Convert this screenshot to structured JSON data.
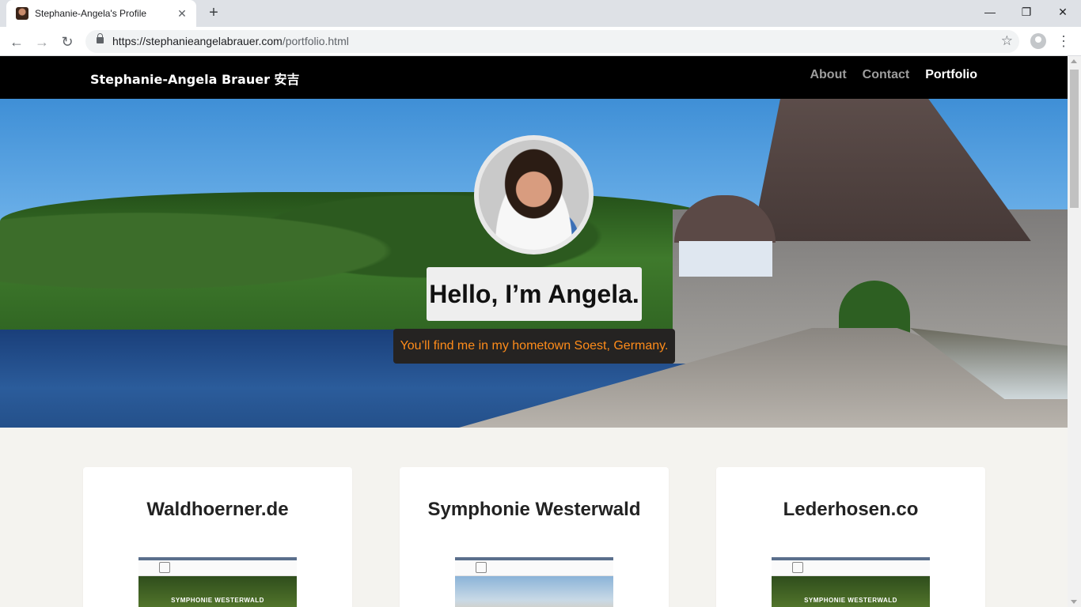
{
  "browser": {
    "tab_title": "Stephanie-Angela's Profile",
    "tab_close": "✕",
    "new_tab": "+",
    "url_host": "https://stephanieangelabrauer.com",
    "url_path": "/portfolio.html",
    "controls": {
      "minimize": "—",
      "maximize": "❐",
      "close": "✕"
    },
    "nav": {
      "back": "←",
      "forward": "→",
      "reload": "↻"
    },
    "star": "☆",
    "menu": "⋮"
  },
  "site": {
    "brand": "Stephanie-Angela Brauer 安吉",
    "nav_links": [
      "About",
      "Contact",
      "Portfolio"
    ],
    "active_link": "Portfolio"
  },
  "hero": {
    "heading": "Hello, I’m Angela.",
    "subheading": "You’ll find me in my hometown Soest, Germany."
  },
  "cards": [
    {
      "title": "Waldhoerner.de",
      "thumb_caption": "SYMPHONIE WESTERWALD"
    },
    {
      "title": "Symphonie Westerwald",
      "thumb_caption": ""
    },
    {
      "title": "Lederhosen.co",
      "thumb_caption": "SYMPHONIE WESTERWALD"
    }
  ],
  "colors": {
    "nav_bg": "#000000",
    "nav_active": "#ffffff",
    "nav_inactive": "#9d9d9d",
    "subheading_text": "#ff8c1a",
    "page_bg": "#f4f3ef"
  },
  "icons": [
    "lock-icon",
    "star-icon",
    "profile-icon",
    "menu-icon"
  ]
}
